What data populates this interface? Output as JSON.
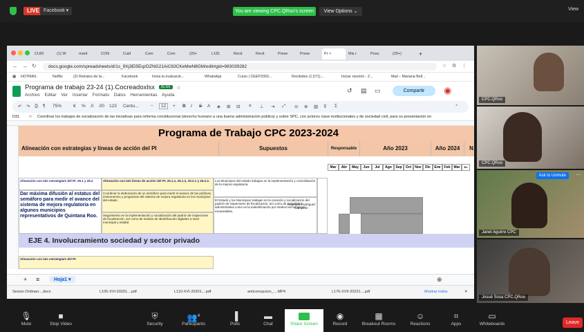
{
  "zoom_top": {
    "live_label": "LIVE",
    "facebook_label": "Facebook ▾",
    "viewing_text": "You are viewing CPC.QRoo's screen",
    "view_options": "View Options ⌄",
    "view_label": "View"
  },
  "browser": {
    "tabs": [
      "CUID",
      "(1) W",
      "marit",
      "CON",
      "Cuid",
      "Com",
      "Com",
      "(20+",
      "L181",
      "Recit",
      "Recit",
      "Prese",
      "Prese",
      "Pr ×",
      "Mis r",
      "Posu",
      "(20+)"
    ],
    "url": "docs.google.com/spreadsheets/d/1s_9Xj3El5EqzDZNG21AiC63CKeMwN8GM/edit#gid=983039282",
    "bookmarks": [
      "HOTMAIL",
      "Netflix",
      "(2) Retratos de la...",
      "Facebook",
      "Inicia la evaluació...",
      "WhatsApp",
      "Curso | CEEP2003...",
      "Recibidos (1,571)...",
      "Iniciar reunión - Z...",
      "Mail – Mariana Bell..."
    ]
  },
  "doc": {
    "title": "Programa de trabajo 23-24 (1).Cocreadoxlsx",
    "badge": "XLSX",
    "menus": [
      "Archivo",
      "Editar",
      "Ver",
      "Insertar",
      "Formato",
      "Datos",
      "Herramientas",
      "Ayuda"
    ],
    "share_label": "Compartir",
    "toolbar": {
      "zoom": "75%",
      "currency": "€",
      "percent": "%",
      "dec1": ".0",
      "dec2": ".00",
      "decimal": "123",
      "font": "Centu...",
      "size": "12"
    },
    "cell_ref": "D31",
    "formula_text": "Coordinar los trabajos de socialización de las iniciativas para reforma constitucional (derecho humano a una buena administración pública) y sobre SPC, con actores clave institucionales y de sociedad civil, para su presentación en"
  },
  "sheet": {
    "title": "Programa de Trabajo CPC 2023-2024",
    "headers": {
      "alineacion": "Alineación con estrategias y líneas de acción del PI",
      "supuestos": "Supuestos",
      "responsable": "Responsable",
      "year1": "Año 2023",
      "year2": "Año 2024",
      "next": "N"
    },
    "months": [
      "Mar",
      "Abr",
      "May",
      "Jun",
      "Jul",
      "Ago",
      "Sep",
      "Oct",
      "Nov",
      "Dic",
      "Ene",
      "Feb",
      "Mar",
      "En"
    ],
    "row_a1": "Alineación con la/s estrategia/s del PI: 25.1 y 25.2",
    "row_a2": "Alineación con la/s líneas de acción del PI: 25.1.1, 25.1.2, 25.2.1 y 25.2.2.",
    "row_main": "Dar máxima difusión al estatus del semáforo para medir el avance del sistema de mejora regulatoria en algunos municipios representativos de Quintana Roo.",
    "row_c1": "Coordinar la elaboración de un semáforo para medir el avance de las políticas, instrumentos y programas del sistema de mejora regulatoria en los municipios del estado.",
    "row_c2": "Seguimiento en la implementación y socialización del padrón de inspectores de fiscalización, así como de medios de identificación digitales a nivel municipal y estatal.",
    "supuesto1": "Los Municipios del estado trabajan en la implementación y consolidación de la mejora regulatoria.",
    "supuesto2": "El Estado y los Municipios trabajan en la creación y socialización del padrón de inspectores de fiscalización, así como de la facilidad administrativa como es la indentificación por medios tecnológicos escaneables.",
    "responsable": "Alejandro Rodríguez Campirán",
    "eje": "EJE 4. Involucramiento sociedad y sector privado",
    "row_bottom": "Alineación con la/s estrategia/s del PI:",
    "sheet_tab": "Hoja1 ▾"
  },
  "downloads": [
    "Sesion Ordinari....docx",
    "L105-XVI-20201....pdf",
    "L110-XVI-20201....pdf",
    "anticorrupcion_....MP4",
    "L176-XVII-20221....pdf"
  ],
  "mostrar_todos": "Mostrar todos",
  "participants": [
    {
      "name": "CPC.QRoo"
    },
    {
      "name": "CPC.QRoo"
    },
    {
      "name": "Janet Aguirre CPC"
    },
    {
      "name": "Josué Sosa CPC.QRoo"
    }
  ],
  "ask_unmute": "Ask to Unmute",
  "controls": [
    "Mute",
    "Stop Video",
    "Security",
    "Participants",
    "Polls",
    "Chat",
    "Share Screen",
    "Record",
    "Breakout Rooms",
    "Reactions",
    "Apps",
    "Whiteboards"
  ],
  "participants_count": "4",
  "leave_label": "Leave"
}
